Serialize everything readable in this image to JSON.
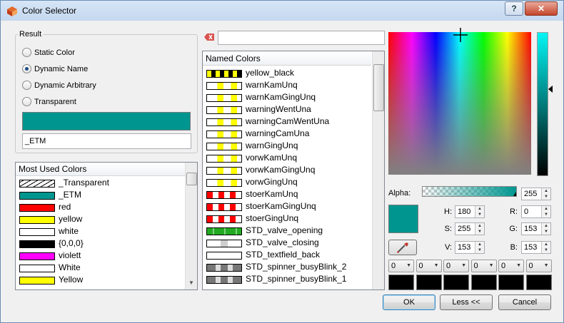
{
  "window": {
    "title": "Color Selector",
    "help_label": "?",
    "close_label": "✕"
  },
  "result": {
    "group_label": "Result",
    "options": [
      {
        "label": "Static Color",
        "checked": false
      },
      {
        "label": "Dynamic Name",
        "checked": true
      },
      {
        "label": "Dynamic Arbitrary",
        "checked": false
      },
      {
        "label": "Transparent",
        "checked": false
      }
    ],
    "preview_color": "#00968f",
    "name_value": "_ETM"
  },
  "most_used": {
    "header": "Most Used Colors",
    "items": [
      {
        "label": "_Transparent",
        "swatch": "transparent"
      },
      {
        "label": "_ETM",
        "swatch": "#00968f"
      },
      {
        "label": "red",
        "swatch": "#ff0000"
      },
      {
        "label": "yellow",
        "swatch": "#ffff00"
      },
      {
        "label": "white",
        "swatch": "#ffffff"
      },
      {
        "label": "{0,0,0}",
        "swatch": "#000000"
      },
      {
        "label": "violett",
        "swatch": "#ff00ff"
      },
      {
        "label": "White",
        "swatch": "#ffffff"
      },
      {
        "label": "Yellow",
        "swatch": "#ffff00"
      }
    ]
  },
  "search": {
    "value": ""
  },
  "named_colors": {
    "header": "Named Colors",
    "items": [
      {
        "label": "yellow_black",
        "swatch": "yellowblack"
      },
      {
        "label": "warnKamUnq",
        "swatch": "yellowwhite"
      },
      {
        "label": "warnKamGingUnq",
        "swatch": "yellowwhite"
      },
      {
        "label": "warningWentUna",
        "swatch": "yellowwhite"
      },
      {
        "label": "warningCamWentUna",
        "swatch": "yellowwhite"
      },
      {
        "label": "warningCamUna",
        "swatch": "yellowwhite"
      },
      {
        "label": "warnGingUnq",
        "swatch": "yellowwhite"
      },
      {
        "label": "vorwKamUnq",
        "swatch": "yellowwhite"
      },
      {
        "label": "vorwKamGingUnq",
        "swatch": "yellowwhite"
      },
      {
        "label": "vorwGingUnq",
        "swatch": "yellowwhite"
      },
      {
        "label": "stoerKamUnq",
        "swatch": "redwhite"
      },
      {
        "label": "stoerKamGingUnq",
        "swatch": "redwhite"
      },
      {
        "label": "stoerGingUnq",
        "swatch": "redwhite"
      },
      {
        "label": "STD_valve_opening",
        "swatch": "greenwhite"
      },
      {
        "label": "STD_valve_closing",
        "swatch": "whitegrey"
      },
      {
        "label": "STD_textfield_back",
        "swatch": "white"
      },
      {
        "label": "STD_spinner_busyBlink_2",
        "swatch": "greyblock"
      },
      {
        "label": "STD_spinner_busyBlink_1",
        "swatch": "greyblock"
      }
    ]
  },
  "picker": {
    "alpha_label": "Alpha:",
    "alpha": 255,
    "current_color": "#00968f",
    "h_label": "H:",
    "h": 180,
    "s_label": "S:",
    "s": 255,
    "v_label": "V:",
    "v": 153,
    "r_label": "R:",
    "r": 0,
    "g_label": "G:",
    "g": 153,
    "b_label": "B:",
    "b": 153
  },
  "custom_colors": [
    {
      "value": "0"
    },
    {
      "value": "0"
    },
    {
      "value": "0"
    },
    {
      "value": "0"
    },
    {
      "value": "0"
    },
    {
      "value": "0"
    }
  ],
  "buttons": {
    "ok": "OK",
    "less": "Less <<",
    "cancel": "Cancel"
  }
}
